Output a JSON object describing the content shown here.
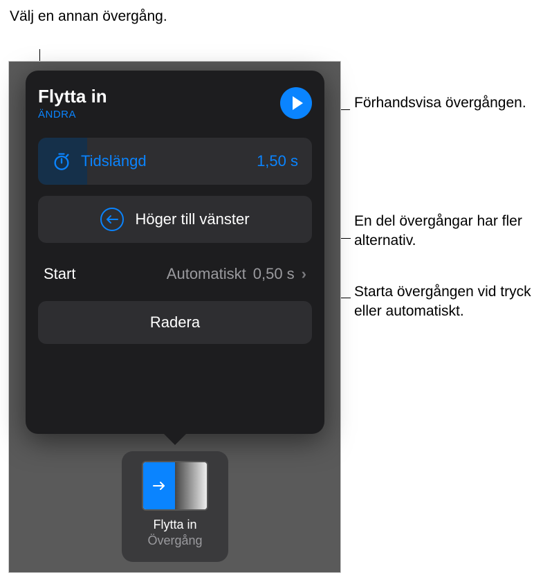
{
  "callouts": {
    "top_left": "Välj en annan övergång.",
    "right1": "Förhandsvisa övergången.",
    "right2": "En del övergångar har fler alternativ.",
    "right3": "Starta övergången vid tryck eller automatiskt."
  },
  "popover": {
    "title": "Flytta in",
    "change": "ÄNDRA",
    "duration_label": "Tidslängd",
    "duration_value": "1,50 s",
    "direction": "Höger till vänster",
    "start_label": "Start",
    "start_mode": "Automatiskt",
    "start_delay": "0,50 s",
    "delete": "Radera"
  },
  "thumbnail": {
    "name": "Flytta in",
    "subtitle": "Övergång"
  }
}
